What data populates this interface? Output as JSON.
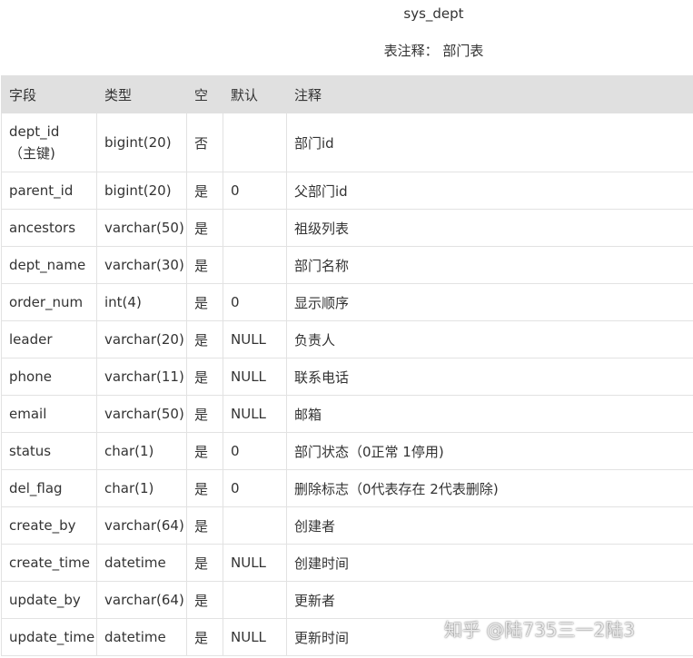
{
  "title": "sys_dept",
  "comment": "表注释： 部门表",
  "headers": [
    "字段",
    "类型",
    "空",
    "默认",
    "注释"
  ],
  "rows": [
    [
      "dept_id （主键)",
      "bigint(20)",
      "否",
      "",
      "部门id"
    ],
    [
      "parent_id",
      "bigint(20)",
      "是",
      "0",
      "父部门id"
    ],
    [
      "ancestors",
      "varchar(50)",
      "是",
      "",
      "祖级列表"
    ],
    [
      "dept_name",
      "varchar(30)",
      "是",
      "",
      "部门名称"
    ],
    [
      "order_num",
      "int(4)",
      "是",
      "0",
      "显示顺序"
    ],
    [
      "leader",
      "varchar(20)",
      "是",
      "NULL",
      "负责人"
    ],
    [
      "phone",
      "varchar(11)",
      "是",
      "NULL",
      "联系电话"
    ],
    [
      "email",
      "varchar(50)",
      "是",
      "NULL",
      "邮箱"
    ],
    [
      "status",
      "char(1)",
      "是",
      "0",
      "部门状态（0正常 1停用)"
    ],
    [
      "del_flag",
      "char(1)",
      "是",
      "0",
      "删除标志（0代表存在 2代表删除)"
    ],
    [
      "create_by",
      "varchar(64)",
      "是",
      "",
      "创建者"
    ],
    [
      "create_time",
      "datetime",
      "是",
      "NULL",
      "创建时间"
    ],
    [
      "update_by",
      "varchar(64)",
      "是",
      "",
      "更新者"
    ],
    [
      "update_time",
      "datetime",
      "是",
      "NULL",
      "更新时间"
    ]
  ],
  "watermark": "知乎 @陆735三一2陆3"
}
